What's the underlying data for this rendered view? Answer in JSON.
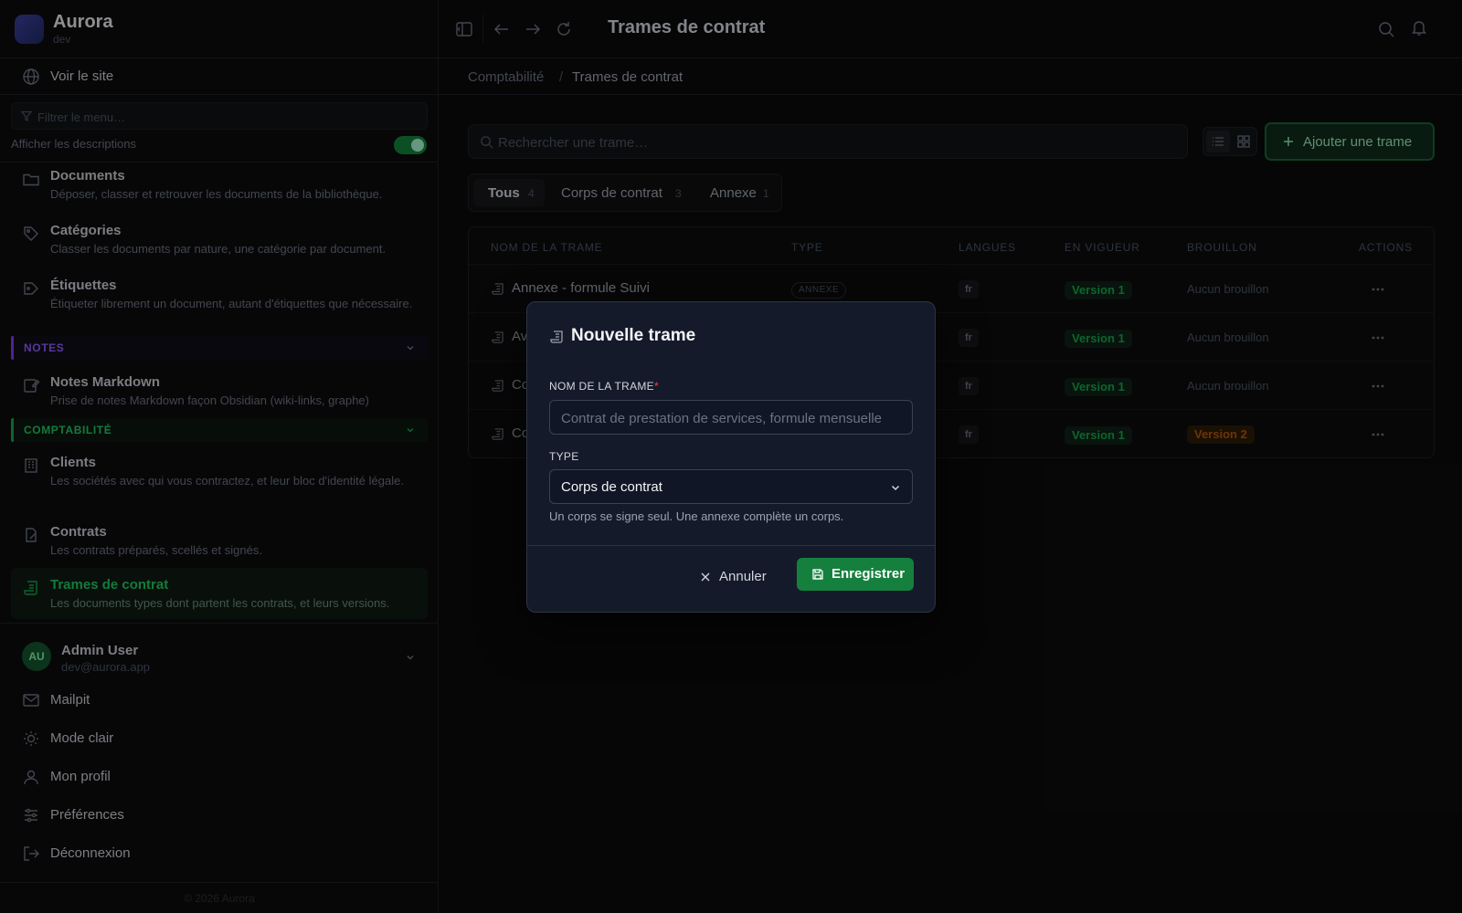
{
  "brand": {
    "name": "Aurora",
    "env": "dev"
  },
  "sidebar": {
    "visit_label": "Voir le site",
    "filter_placeholder": "Filtrer le menu…",
    "show_descriptions_label": "Afficher les descriptions",
    "show_descriptions_on": true,
    "items": [
      {
        "title": "Documents",
        "desc": "Déposer, classer et retrouver les documents de la bibliothèque.",
        "icon": "folder-icon"
      },
      {
        "title": "Catégories",
        "desc": "Classer les documents par nature, une catégorie par document.",
        "icon": "tag-icon"
      },
      {
        "title": "Étiquettes",
        "desc": "Étiqueter librement un document, autant d'étiquettes que nécessaire.",
        "icon": "label-icon"
      }
    ],
    "section_notes": "NOTES",
    "notes_items": [
      {
        "title": "Notes Markdown",
        "desc": "Prise de notes Markdown façon Obsidian (wiki-links, graphe)",
        "icon": "note-edit-icon"
      }
    ],
    "section_compta": "COMPTABILITÉ",
    "compta_items": [
      {
        "title": "Clients",
        "desc": "Les sociétés avec qui vous contractez, et leur bloc d'identité légale.",
        "icon": "building-icon"
      },
      {
        "title": "Contrats",
        "desc": "Les contrats préparés, scellés et signés.",
        "icon": "contract-icon"
      },
      {
        "title": "Trames de contrat",
        "desc": "Les documents types dont partent les contrats, et leurs versions.",
        "icon": "scroll-icon"
      }
    ],
    "user": {
      "initials": "AU",
      "name": "Admin User",
      "email": "dev@aurora.app"
    },
    "bottom": [
      {
        "label": "Mailpit",
        "icon": "mail-icon"
      },
      {
        "label": "Mode clair",
        "icon": "sun-icon"
      },
      {
        "label": "Mon profil",
        "icon": "user-icon"
      },
      {
        "label": "Préférences",
        "icon": "sliders-icon"
      },
      {
        "label": "Déconnexion",
        "icon": "logout-icon"
      }
    ],
    "footer": "© 2026 Aurora"
  },
  "header": {
    "title": "Trames de contrat",
    "breadcrumb": [
      "Comptabilité",
      "Trames de contrat"
    ]
  },
  "toolbar": {
    "search_placeholder": "Rechercher une trame…",
    "add_label": "Ajouter une trame"
  },
  "tabs": [
    {
      "label": "Tous",
      "count": "4"
    },
    {
      "label": "Corps de contrat",
      "count": "3"
    },
    {
      "label": "Annexe",
      "count": "1"
    }
  ],
  "table": {
    "headers": [
      "NOM DE LA TRAME",
      "TYPE",
      "LANGUES",
      "EN VIGUEUR",
      "BROUILLON",
      "ACTIONS"
    ],
    "rows": [
      {
        "name": "Annexe - formule Suivi",
        "type": "ANNEXE",
        "lang": "fr",
        "current": "Version 1",
        "draft": "Aucun brouillon"
      },
      {
        "name": "Av",
        "type": "",
        "lang": "fr",
        "current": "Version 1",
        "draft": "Aucun brouillon"
      },
      {
        "name": "Co",
        "type": "",
        "lang": "fr",
        "current": "Version 1",
        "draft": "Aucun brouillon"
      },
      {
        "name": "Co",
        "type": "",
        "lang": "fr",
        "current": "Version 1",
        "draft": "Version 2"
      }
    ]
  },
  "modal": {
    "title": "Nouvelle trame",
    "name_label": "NOM DE LA TRAME",
    "required_mark": "*",
    "name_placeholder": "Contrat de prestation de services, formule mensuelle",
    "type_label": "TYPE",
    "type_value": "Corps de contrat",
    "hint": "Un corps se signe seul. Une annexe complète un corps.",
    "cancel_label": "Annuler",
    "save_label": "Enregistrer"
  },
  "colors": {
    "accent": "#16a34a",
    "modal_bg": "#141a2a",
    "warning": "#b45309",
    "notes_section": "#7c3aed"
  }
}
